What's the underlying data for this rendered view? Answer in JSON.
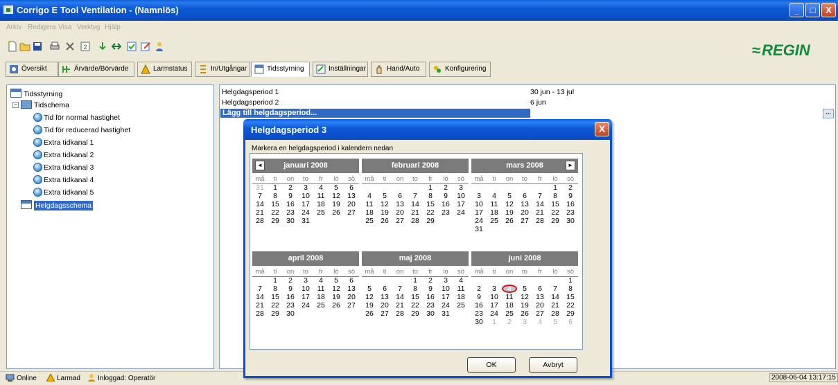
{
  "window": {
    "title": "Corrigo E Tool Ventilation - (Namnlös)",
    "min": "_",
    "max": "□",
    "close": "X"
  },
  "menu": [
    "Arkiv",
    "Redigera",
    "Visa",
    "Verktyg",
    "Hjälp"
  ],
  "logo": "REGIN",
  "tabs": [
    "Översikt",
    "Ärvärde/Börvärde",
    "Larmstatus",
    "In/Utgångar",
    "Tidsstyrning",
    "Inställningar",
    "Hand/Auto",
    "Konfigurering"
  ],
  "tree": {
    "root": "Tidsstyrning",
    "schedule": "Tidschema",
    "children": [
      "Tid för normal hastighet",
      "Tid för reducerad hastighet",
      "Extra tidkanal 1",
      "Extra tidkanal 2",
      "Extra tidkanal 3",
      "Extra tidkanal 4",
      "Extra tidkanal 5"
    ],
    "holiday": "Helgdagsschema"
  },
  "periods": [
    {
      "name": "Helgdagsperiod 1",
      "range": "30 jun - 13 jul"
    },
    {
      "name": "Helgdagsperiod 2",
      "range": "6 jun"
    }
  ],
  "add_period": "Lägg till helgdagsperiod...",
  "ellipsis": "...",
  "dialog": {
    "title": "Helgdagsperiod 3",
    "instruction": "Markera en helgdagsperiod i kalendern nedan",
    "ok": "OK",
    "cancel": "Avbryt",
    "close": "X",
    "prev": "◄",
    "next": "►"
  },
  "day_names": [
    "må",
    "ti",
    "on",
    "to",
    "fr",
    "lö",
    "sö"
  ],
  "months": [
    {
      "name": "januari 2008",
      "lead": [
        "31"
      ],
      "days": 31,
      "trail": []
    },
    {
      "name": "februari 2008",
      "lead": [
        "",
        "",
        "",
        ""
      ],
      "days": 29,
      "trail": []
    },
    {
      "name": "mars 2008",
      "lead": [
        "",
        "",
        "",
        "",
        ""
      ],
      "days": 31,
      "trail": []
    },
    {
      "name": "april 2008",
      "lead": [
        ""
      ],
      "days": 30,
      "trail": []
    },
    {
      "name": "maj 2008",
      "lead": [
        "",
        "",
        ""
      ],
      "days": 31,
      "trail": []
    },
    {
      "name": "juni 2008",
      "lead": [
        "",
        "",
        "",
        "",
        "",
        ""
      ],
      "days": 30,
      "trail": [
        "1",
        "2",
        "3",
        "4",
        "5",
        "6"
      ],
      "today": 4
    }
  ],
  "status": {
    "online": "Online",
    "alarm": "Larmad",
    "login": "Inloggad: Operatör",
    "datetime": "2008-06-04  13:17:15"
  },
  "colors": {
    "titlebar": "#0a4fc8",
    "selection": "#316ac5",
    "logo": "#0f8a3a",
    "today_ring": "#d81010"
  }
}
